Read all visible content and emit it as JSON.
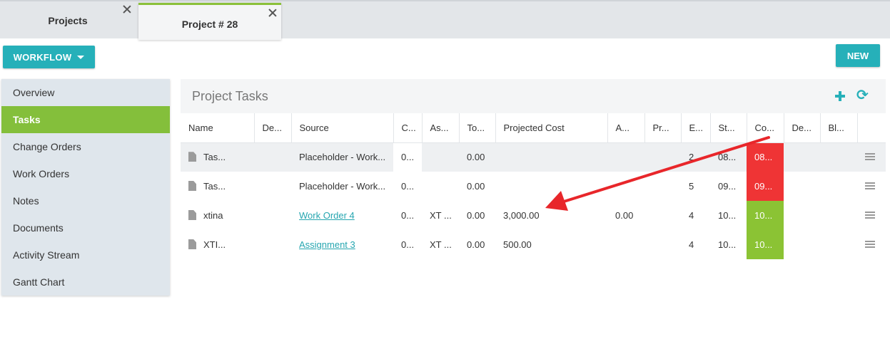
{
  "tabs": [
    {
      "label": "Projects"
    },
    {
      "label": "Project # 28"
    }
  ],
  "toolbar": {
    "workflow_label": "WORKFLOW",
    "new_label": "NEW"
  },
  "sidebar": {
    "items": [
      {
        "label": "Overview"
      },
      {
        "label": "Tasks"
      },
      {
        "label": "Change Orders"
      },
      {
        "label": "Work Orders"
      },
      {
        "label": "Notes"
      },
      {
        "label": "Documents"
      },
      {
        "label": "Activity Stream"
      },
      {
        "label": "Gantt Chart"
      }
    ],
    "active": "Tasks"
  },
  "panel": {
    "title": "Project Tasks",
    "icons": [
      "plus-icon",
      "refresh-icon"
    ]
  },
  "table": {
    "headers": [
      "Name",
      "De...",
      "Source",
      "C...",
      "As...",
      "To...",
      "Projected Cost",
      "A...",
      "Pr...",
      "E...",
      "St...",
      "Co...",
      "De...",
      "Bl...",
      ""
    ],
    "rows": [
      {
        "name": "Tas...",
        "de": "",
        "source": "Placeholder - Work...",
        "c": "0...",
        "as": "",
        "to": "0.00",
        "projected_cost": "",
        "a": "",
        "pr": "",
        "e": "2",
        "st": "08...",
        "co": "08...",
        "de2": "",
        "bl": ""
      },
      {
        "name": "Tas...",
        "de": "",
        "source": "Placeholder - Work...",
        "c": "0...",
        "as": "",
        "to": "0.00",
        "projected_cost": "",
        "a": "",
        "pr": "",
        "e": "5",
        "st": "09...",
        "co": "09...",
        "de2": "",
        "bl": ""
      },
      {
        "name": "xtina",
        "de": "",
        "source": "Work Order 4",
        "c": "0...",
        "as": "XT ...",
        "to": "0.00",
        "projected_cost": "3,000.00",
        "a": "0.00",
        "pr": "",
        "e": "4",
        "st": "10...",
        "co": "10...",
        "de2": "",
        "bl": ""
      },
      {
        "name": "XTI...",
        "de": "",
        "source": "Assignment 3",
        "c": "0...",
        "as": "XT ...",
        "to": "0.00",
        "projected_cost": "500.00",
        "a": "",
        "pr": "",
        "e": "4",
        "st": "10...",
        "co": "10...",
        "de2": "",
        "bl": ""
      }
    ]
  },
  "colors": {
    "accent": "#26b0b9",
    "active_green": "#84bf3b",
    "status_red": "#ef3435",
    "status_green": "#8bc334",
    "annotation_arrow": "#e8262a"
  }
}
